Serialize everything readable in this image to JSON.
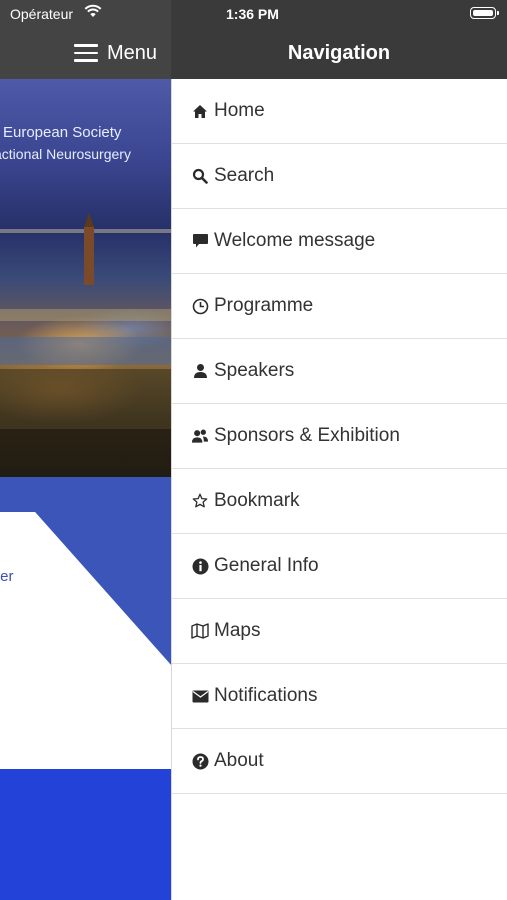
{
  "status_bar": {
    "carrier": "Opérateur",
    "time": "1:36 PM"
  },
  "header": {
    "menu_label": "Menu",
    "nav_title": "Navigation"
  },
  "background_app": {
    "banner_line1": "European Society",
    "banner_line2": "actional Neurosurgery",
    "link_fragment": "ter",
    "accent_color": "#2343d8"
  },
  "navigation": {
    "items": [
      {
        "label": "Home",
        "icon": "home-icon"
      },
      {
        "label": "Search",
        "icon": "search-icon"
      },
      {
        "label": "Welcome message",
        "icon": "message-icon"
      },
      {
        "label": "Programme",
        "icon": "clock-icon"
      },
      {
        "label": "Speakers",
        "icon": "user-icon"
      },
      {
        "label": "Sponsors & Exhibition",
        "icon": "users-icon"
      },
      {
        "label": "Bookmark",
        "icon": "star-icon"
      },
      {
        "label": "General Info",
        "icon": "info-icon"
      },
      {
        "label": "Maps",
        "icon": "map-icon"
      },
      {
        "label": "Notifications",
        "icon": "envelope-icon"
      },
      {
        "label": "About",
        "icon": "question-icon"
      }
    ]
  }
}
